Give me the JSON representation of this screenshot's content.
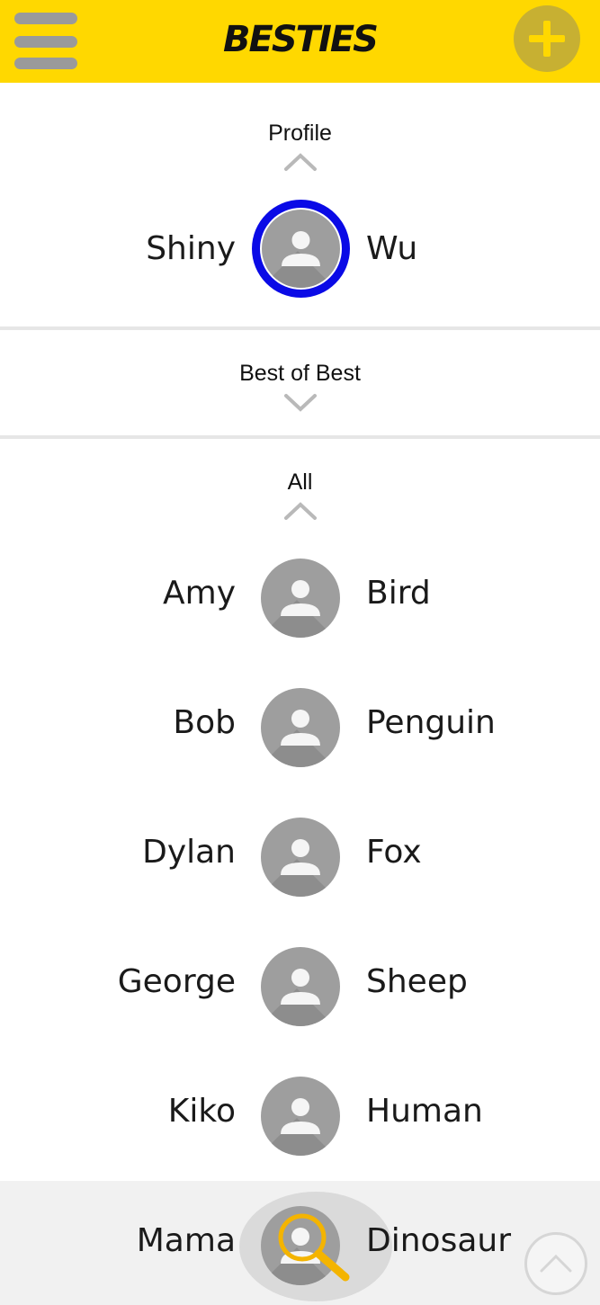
{
  "header": {
    "title": "BESTIES",
    "menu_icon": "hamburger-menu-icon",
    "add_icon": "plus-icon",
    "brand_color": "#ffd800"
  },
  "profile_section": {
    "label": "Profile",
    "toggle_icon": "chevron-up-icon",
    "person": {
      "first": "Shiny",
      "last": "Wu",
      "ring_color": "#0a0ae6"
    }
  },
  "best_section": {
    "label": "Best of Best",
    "toggle_icon": "chevron-down-icon"
  },
  "all_section": {
    "label": "All",
    "toggle_icon": "chevron-up-icon",
    "people": [
      {
        "first": "Amy",
        "last": "Bird"
      },
      {
        "first": "Bob",
        "last": "Penguin"
      },
      {
        "first": "Dylan",
        "last": "Fox"
      },
      {
        "first": "George",
        "last": "Sheep"
      },
      {
        "first": "Kiko",
        "last": "Human"
      },
      {
        "first": "Mama",
        "last": "Dinosaur"
      }
    ]
  },
  "floating": {
    "search_icon": "magnifier-icon",
    "scroll_top_icon": "chevron-up-circle-icon"
  }
}
